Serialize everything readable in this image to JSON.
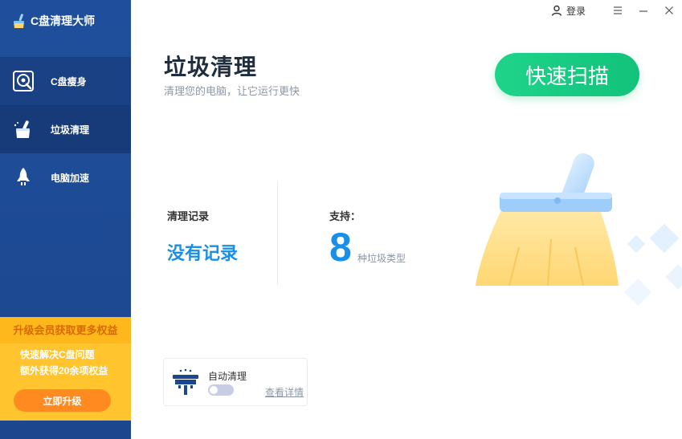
{
  "app": {
    "title": "C盘清理大师"
  },
  "titlebar": {
    "login_label": "登录"
  },
  "sidebar": {
    "items": [
      {
        "label": "C盘瘦身",
        "icon": "disk-clean-icon"
      },
      {
        "label": "垃圾清理",
        "icon": "broom-icon"
      },
      {
        "label": "电脑加速",
        "icon": "rocket-icon"
      }
    ],
    "promo": {
      "title": "升级会员获取更多权益",
      "line1": "快速解决C盘问题",
      "line2": "额外获得20余项权益",
      "button_label": "立即升级"
    }
  },
  "main": {
    "title": "垃圾清理",
    "subtitle": "清理您的电脑，让它运行更快",
    "scan_button_label": "快速扫描",
    "record_label": "清理记录",
    "record_value": "没有记录",
    "support_label": "支持：",
    "support_number": "8",
    "support_unit": "种垃圾类型"
  },
  "auto_clean": {
    "label": "自动清理",
    "toggle_on": false,
    "details_link": "查看详情"
  },
  "colors": {
    "sidebar_bg": "#1f4f9c",
    "active_item_bg": "#173a78",
    "accent_blue": "#1a8fe8",
    "scan_green": "#12c27a",
    "promo_yellow": "#ffc42e",
    "promo_orange": "#ff8a1f"
  }
}
